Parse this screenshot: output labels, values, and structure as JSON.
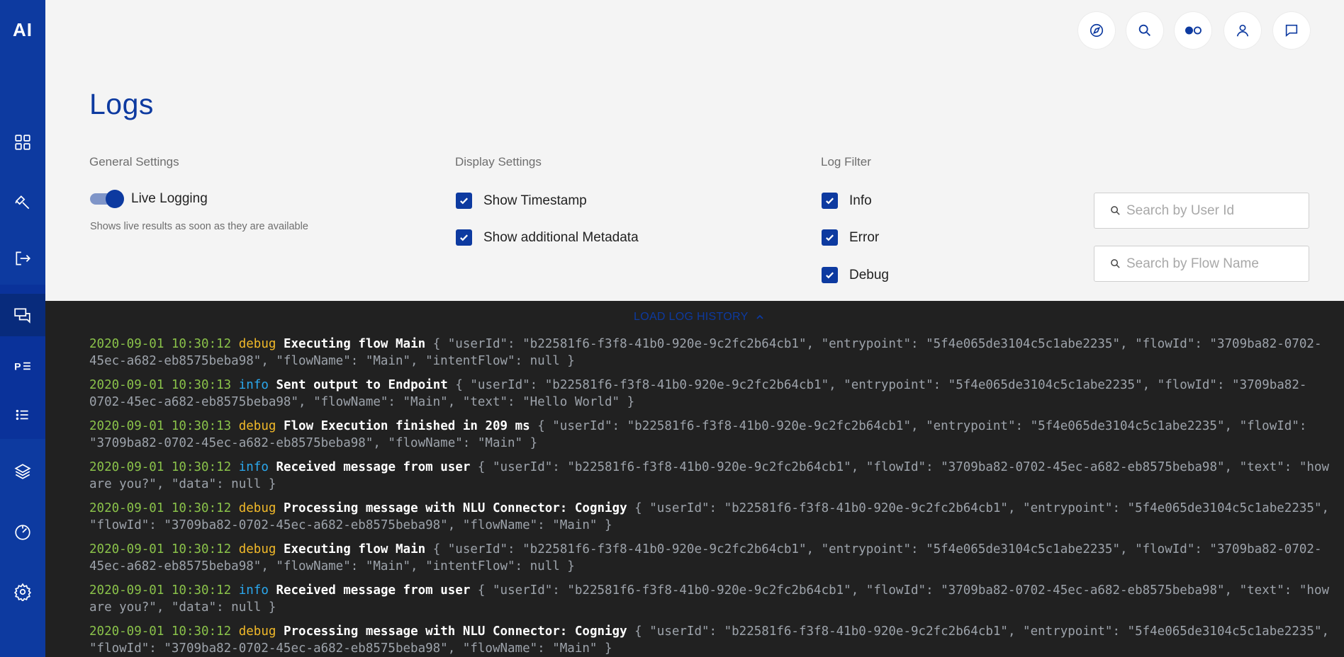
{
  "app": {
    "logo_text": "AI",
    "page_title": "Logs"
  },
  "header": {
    "icons": [
      "compass-icon",
      "search-icon",
      "toggle-dots-icon",
      "user-icon",
      "chat-icon"
    ]
  },
  "sidebar": {
    "items": [
      {
        "icon": "dashboard-icon"
      },
      {
        "icon": "build-icon"
      },
      {
        "icon": "deploy-icon"
      },
      {
        "icon": "conversations-icon",
        "active": true
      },
      {
        "icon": "profiles-icon",
        "label": "P"
      },
      {
        "icon": "list-icon"
      },
      {
        "icon": "layers-icon"
      },
      {
        "icon": "analytics-icon"
      },
      {
        "icon": "settings-icon"
      }
    ]
  },
  "general_settings": {
    "label": "General Settings",
    "live_logging_label": "Live Logging",
    "live_logging_enabled": true,
    "help_text": "Shows live results as soon as they are available"
  },
  "display_settings": {
    "label": "Display Settings",
    "show_timestamp": {
      "label": "Show Timestamp",
      "checked": true
    },
    "show_metadata": {
      "label": "Show additional Metadata",
      "checked": true
    }
  },
  "log_filter": {
    "label": "Log Filter",
    "info": {
      "label": "Info",
      "checked": true
    },
    "error": {
      "label": "Error",
      "checked": true
    },
    "debug": {
      "label": "Debug",
      "checked": true
    }
  },
  "search": {
    "user_placeholder": "Search by User Id",
    "flow_placeholder": "Search by Flow Name"
  },
  "log_panel": {
    "load_history_label": "LOAD LOG HISTORY",
    "lines": [
      {
        "timestamp": "2020-09-01 10:30:12",
        "level": "debug",
        "message": "Executing flow Main",
        "meta": "{ \"userId\": \"b22581f6-f3f8-41b0-920e-9c2fc2b64cb1\", \"entrypoint\": \"5f4e065de3104c5c1abe2235\", \"flowId\": \"3709ba82-0702-45ec-a682-eb8575beba98\", \"flowName\": \"Main\", \"intentFlow\": null }"
      },
      {
        "timestamp": "2020-09-01 10:30:13",
        "level": "info",
        "message": "Sent output to Endpoint",
        "meta": "{ \"userId\": \"b22581f6-f3f8-41b0-920e-9c2fc2b64cb1\", \"entrypoint\": \"5f4e065de3104c5c1abe2235\", \"flowId\": \"3709ba82-0702-45ec-a682-eb8575beba98\", \"flowName\": \"Main\", \"text\": \"Hello World\" }"
      },
      {
        "timestamp": "2020-09-01 10:30:13",
        "level": "debug",
        "message": "Flow Execution finished in 209 ms",
        "meta": "{ \"userId\": \"b22581f6-f3f8-41b0-920e-9c2fc2b64cb1\", \"entrypoint\": \"5f4e065de3104c5c1abe2235\", \"flowId\": \"3709ba82-0702-45ec-a682-eb8575beba98\", \"flowName\": \"Main\" }"
      },
      {
        "timestamp": "2020-09-01 10:30:12",
        "level": "info",
        "message": "Received message from user",
        "meta": "{ \"userId\": \"b22581f6-f3f8-41b0-920e-9c2fc2b64cb1\", \"flowId\": \"3709ba82-0702-45ec-a682-eb8575beba98\", \"text\": \"how are you?\", \"data\": null }"
      },
      {
        "timestamp": "2020-09-01 10:30:12",
        "level": "debug",
        "message": "Processing message with NLU Connector: Cognigy",
        "meta": "{ \"userId\": \"b22581f6-f3f8-41b0-920e-9c2fc2b64cb1\", \"entrypoint\": \"5f4e065de3104c5c1abe2235\", \"flowId\": \"3709ba82-0702-45ec-a682-eb8575beba98\", \"flowName\": \"Main\" }"
      },
      {
        "timestamp": "2020-09-01 10:30:12",
        "level": "debug",
        "message": "Executing flow Main",
        "meta": "{ \"userId\": \"b22581f6-f3f8-41b0-920e-9c2fc2b64cb1\", \"entrypoint\": \"5f4e065de3104c5c1abe2235\", \"flowId\": \"3709ba82-0702-45ec-a682-eb8575beba98\", \"flowName\": \"Main\", \"intentFlow\": null }"
      },
      {
        "timestamp": "2020-09-01 10:30:12",
        "level": "info",
        "message": "Received message from user",
        "meta": "{ \"userId\": \"b22581f6-f3f8-41b0-920e-9c2fc2b64cb1\", \"flowId\": \"3709ba82-0702-45ec-a682-eb8575beba98\", \"text\": \"how are you?\", \"data\": null }"
      },
      {
        "timestamp": "2020-09-01 10:30:12",
        "level": "debug",
        "message": "Processing message with NLU Connector: Cognigy",
        "meta": "{ \"userId\": \"b22581f6-f3f8-41b0-920e-9c2fc2b64cb1\", \"entrypoint\": \"5f4e065de3104c5c1abe2235\", \"flowId\": \"3709ba82-0702-45ec-a682-eb8575beba98\", \"flowName\": \"Main\" }"
      }
    ]
  }
}
